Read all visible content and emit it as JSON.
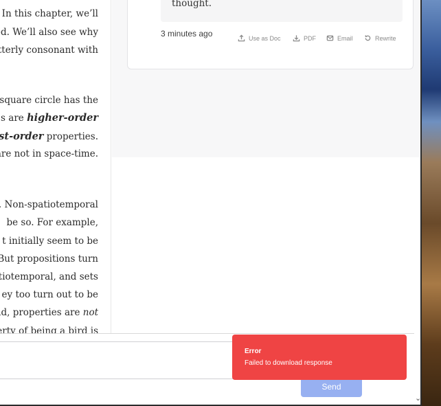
{
  "document": {
    "lines": [
      {
        "parts": [
          {
            "t": "). In this chapter, we’ll",
            "s": "n"
          }
        ]
      },
      {
        "parts": [
          {
            "t": "ined. We’ll also see why",
            "s": "n"
          }
        ]
      },
      {
        "parts": [
          {
            "t": " utterly consonant with",
            "s": "n"
          }
        ]
      },
      {
        "parts": [
          {
            "t": "a square circle has the",
            "s": "n"
          }
        ]
      },
      {
        "parts": [
          {
            "t": "s are ",
            "s": "n"
          },
          {
            "t": "higher-order",
            "s": "b"
          }
        ]
      },
      {
        "parts": [
          {
            "t": "first-order",
            "s": "b"
          },
          {
            "t": " properties.",
            "s": "n"
          }
        ]
      },
      {
        "parts": [
          {
            "t": " are not in space-time.",
            "s": "n"
          }
        ]
      },
      {
        "parts": [
          {
            "t": "ne. Non-spatiotemporal",
            "s": "n"
          }
        ]
      },
      {
        "parts": [
          {
            "t": " be so. For example,",
            "s": "n"
          }
        ]
      },
      {
        "parts": [
          {
            "t": "t initially seem to be",
            "s": "n"
          }
        ]
      },
      {
        "parts": [
          {
            "t": ") But propositions turn",
            "s": "n"
          }
        ]
      },
      {
        "parts": [
          {
            "t": "patiotemporal, and sets",
            "s": "n"
          }
        ]
      },
      {
        "parts": [
          {
            "t": "ey too turn out to be",
            "s": "n"
          }
        ]
      },
      {
        "parts": [
          {
            "t": "aid, properties are ",
            "s": "n"
          },
          {
            "t": "not",
            "s": "i"
          }
        ]
      },
      {
        "parts": [
          {
            "t": "perty of being a bird is",
            "s": "n"
          }
        ]
      }
    ]
  },
  "response": {
    "quote_tail": "thought.",
    "timestamp": "3 minutes ago",
    "actions": [
      {
        "label": "Use as Doc",
        "icon": "upload-icon"
      },
      {
        "label": "PDF",
        "icon": "download-icon"
      },
      {
        "label": "Email",
        "icon": "mail-icon"
      },
      {
        "label": "Rewrite",
        "icon": "rewrite-icon"
      }
    ]
  },
  "composer": {
    "send_label": "Send"
  },
  "toast": {
    "title": "Error",
    "message": "Failed to download response",
    "color": "#ef4444"
  },
  "colors": {
    "send_button": "#97b0f1",
    "panel_bg": "#f7f7f8"
  }
}
